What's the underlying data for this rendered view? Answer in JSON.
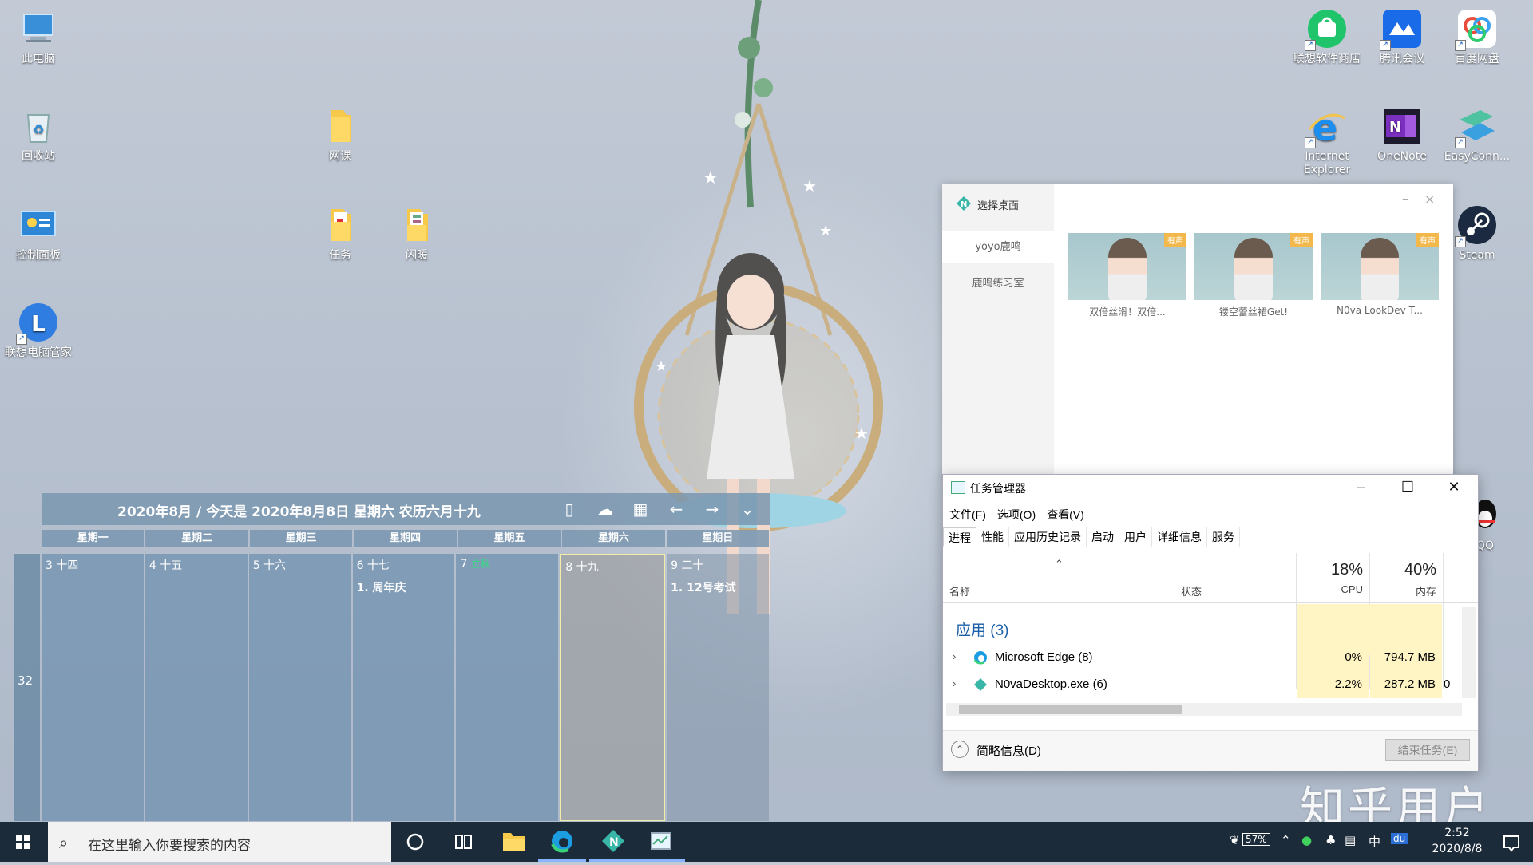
{
  "desktop": {
    "left_icons": [
      "此电脑",
      "回收站",
      "控制面板",
      "联想电脑管家"
    ],
    "folders": [
      "网课",
      "任务",
      "闪暖"
    ],
    "right_icons": [
      "联想软件商店",
      "腾讯会议",
      "百度网盘",
      "Internet Explorer",
      "OneNote",
      "EasyConn...",
      "Steam",
      "QQ"
    ]
  },
  "calendar": {
    "title": "2020年8月 / 今天是 2020年8月8日 星期六 农历六月十九",
    "weekdays": [
      "星期一",
      "星期二",
      "星期三",
      "星期四",
      "星期五",
      "星期六",
      "星期日"
    ],
    "week_number": "32",
    "days": [
      {
        "date": "3 十四",
        "term": "",
        "event": ""
      },
      {
        "date": "4 十五",
        "term": "",
        "event": ""
      },
      {
        "date": "5 十六",
        "term": "",
        "event": ""
      },
      {
        "date": "6 十七",
        "term": "",
        "event": "1.  周年庆"
      },
      {
        "date": "7",
        "term": "立秋",
        "event": ""
      },
      {
        "date": "8 十九",
        "term": "",
        "event": ""
      },
      {
        "date": "9 二十",
        "term": "",
        "event": "1.  12号考试"
      }
    ]
  },
  "picker": {
    "title": "选择桌面",
    "sidebar": [
      "yoyo鹿鸣",
      "鹿鸣练习室"
    ],
    "badge": "有声",
    "thumbs": [
      "双倍丝滑！双倍...",
      "镂空蕾丝裙Get!",
      "N0va LookDev T..."
    ]
  },
  "taskmgr": {
    "title": "任务管理器",
    "menu": [
      "文件(F)",
      "选项(O)",
      "查看(V)"
    ],
    "tabs": [
      "进程",
      "性能",
      "应用历史记录",
      "启动",
      "用户",
      "详细信息",
      "服务"
    ],
    "col_name": "名称",
    "col_status": "状态",
    "cpu_pct": "18%",
    "cpu_label": "CPU",
    "mem_pct": "40%",
    "mem_label": "内存",
    "group": "应用 (3)",
    "rows": [
      {
        "name": "Microsoft Edge (8)",
        "cpu": "0%",
        "mem": "794.7 MB",
        "disk": ""
      },
      {
        "name": "N0vaDesktop.exe (6)",
        "cpu": "2.2%",
        "mem": "287.2 MB",
        "disk": "0"
      }
    ],
    "fewer": "简略信息(D)",
    "end_task": "结束任务(E)"
  },
  "watermark": "知乎用户",
  "taskbar": {
    "search_placeholder": "在这里输入你要搜索的内容",
    "battery": "57%",
    "ime": "中",
    "time": "2:52",
    "date": "2020/8/8"
  },
  "colors": {
    "accent": "#1b5fa8",
    "today_border": "#f1eda6",
    "heat": "#fff4c4"
  }
}
